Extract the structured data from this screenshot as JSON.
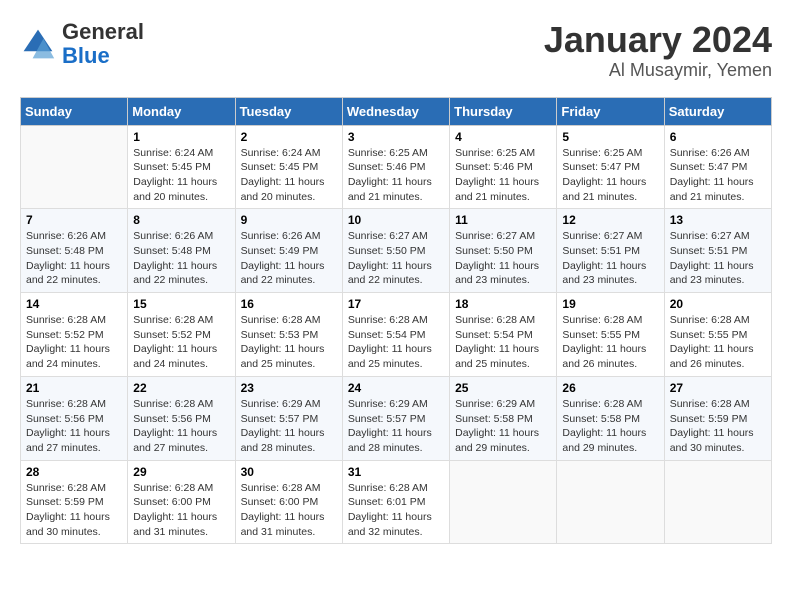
{
  "logo": {
    "general": "General",
    "blue": "Blue"
  },
  "header": {
    "title": "January 2024",
    "subtitle": "Al Musaymir, Yemen"
  },
  "days_of_week": [
    "Sunday",
    "Monday",
    "Tuesday",
    "Wednesday",
    "Thursday",
    "Friday",
    "Saturday"
  ],
  "weeks": [
    [
      {
        "day": "",
        "info": ""
      },
      {
        "day": "1",
        "info": "Sunrise: 6:24 AM\nSunset: 5:45 PM\nDaylight: 11 hours and 20 minutes."
      },
      {
        "day": "2",
        "info": "Sunrise: 6:24 AM\nSunset: 5:45 PM\nDaylight: 11 hours and 20 minutes."
      },
      {
        "day": "3",
        "info": "Sunrise: 6:25 AM\nSunset: 5:46 PM\nDaylight: 11 hours and 21 minutes."
      },
      {
        "day": "4",
        "info": "Sunrise: 6:25 AM\nSunset: 5:46 PM\nDaylight: 11 hours and 21 minutes."
      },
      {
        "day": "5",
        "info": "Sunrise: 6:25 AM\nSunset: 5:47 PM\nDaylight: 11 hours and 21 minutes."
      },
      {
        "day": "6",
        "info": "Sunrise: 6:26 AM\nSunset: 5:47 PM\nDaylight: 11 hours and 21 minutes."
      }
    ],
    [
      {
        "day": "7",
        "info": "Sunrise: 6:26 AM\nSunset: 5:48 PM\nDaylight: 11 hours and 22 minutes."
      },
      {
        "day": "8",
        "info": "Sunrise: 6:26 AM\nSunset: 5:48 PM\nDaylight: 11 hours and 22 minutes."
      },
      {
        "day": "9",
        "info": "Sunrise: 6:26 AM\nSunset: 5:49 PM\nDaylight: 11 hours and 22 minutes."
      },
      {
        "day": "10",
        "info": "Sunrise: 6:27 AM\nSunset: 5:50 PM\nDaylight: 11 hours and 22 minutes."
      },
      {
        "day": "11",
        "info": "Sunrise: 6:27 AM\nSunset: 5:50 PM\nDaylight: 11 hours and 23 minutes."
      },
      {
        "day": "12",
        "info": "Sunrise: 6:27 AM\nSunset: 5:51 PM\nDaylight: 11 hours and 23 minutes."
      },
      {
        "day": "13",
        "info": "Sunrise: 6:27 AM\nSunset: 5:51 PM\nDaylight: 11 hours and 23 minutes."
      }
    ],
    [
      {
        "day": "14",
        "info": "Sunrise: 6:28 AM\nSunset: 5:52 PM\nDaylight: 11 hours and 24 minutes."
      },
      {
        "day": "15",
        "info": "Sunrise: 6:28 AM\nSunset: 5:52 PM\nDaylight: 11 hours and 24 minutes."
      },
      {
        "day": "16",
        "info": "Sunrise: 6:28 AM\nSunset: 5:53 PM\nDaylight: 11 hours and 25 minutes."
      },
      {
        "day": "17",
        "info": "Sunrise: 6:28 AM\nSunset: 5:54 PM\nDaylight: 11 hours and 25 minutes."
      },
      {
        "day": "18",
        "info": "Sunrise: 6:28 AM\nSunset: 5:54 PM\nDaylight: 11 hours and 25 minutes."
      },
      {
        "day": "19",
        "info": "Sunrise: 6:28 AM\nSunset: 5:55 PM\nDaylight: 11 hours and 26 minutes."
      },
      {
        "day": "20",
        "info": "Sunrise: 6:28 AM\nSunset: 5:55 PM\nDaylight: 11 hours and 26 minutes."
      }
    ],
    [
      {
        "day": "21",
        "info": "Sunrise: 6:28 AM\nSunset: 5:56 PM\nDaylight: 11 hours and 27 minutes."
      },
      {
        "day": "22",
        "info": "Sunrise: 6:28 AM\nSunset: 5:56 PM\nDaylight: 11 hours and 27 minutes."
      },
      {
        "day": "23",
        "info": "Sunrise: 6:29 AM\nSunset: 5:57 PM\nDaylight: 11 hours and 28 minutes."
      },
      {
        "day": "24",
        "info": "Sunrise: 6:29 AM\nSunset: 5:57 PM\nDaylight: 11 hours and 28 minutes."
      },
      {
        "day": "25",
        "info": "Sunrise: 6:29 AM\nSunset: 5:58 PM\nDaylight: 11 hours and 29 minutes."
      },
      {
        "day": "26",
        "info": "Sunrise: 6:28 AM\nSunset: 5:58 PM\nDaylight: 11 hours and 29 minutes."
      },
      {
        "day": "27",
        "info": "Sunrise: 6:28 AM\nSunset: 5:59 PM\nDaylight: 11 hours and 30 minutes."
      }
    ],
    [
      {
        "day": "28",
        "info": "Sunrise: 6:28 AM\nSunset: 5:59 PM\nDaylight: 11 hours and 30 minutes."
      },
      {
        "day": "29",
        "info": "Sunrise: 6:28 AM\nSunset: 6:00 PM\nDaylight: 11 hours and 31 minutes."
      },
      {
        "day": "30",
        "info": "Sunrise: 6:28 AM\nSunset: 6:00 PM\nDaylight: 11 hours and 31 minutes."
      },
      {
        "day": "31",
        "info": "Sunrise: 6:28 AM\nSunset: 6:01 PM\nDaylight: 11 hours and 32 minutes."
      },
      {
        "day": "",
        "info": ""
      },
      {
        "day": "",
        "info": ""
      },
      {
        "day": "",
        "info": ""
      }
    ]
  ]
}
